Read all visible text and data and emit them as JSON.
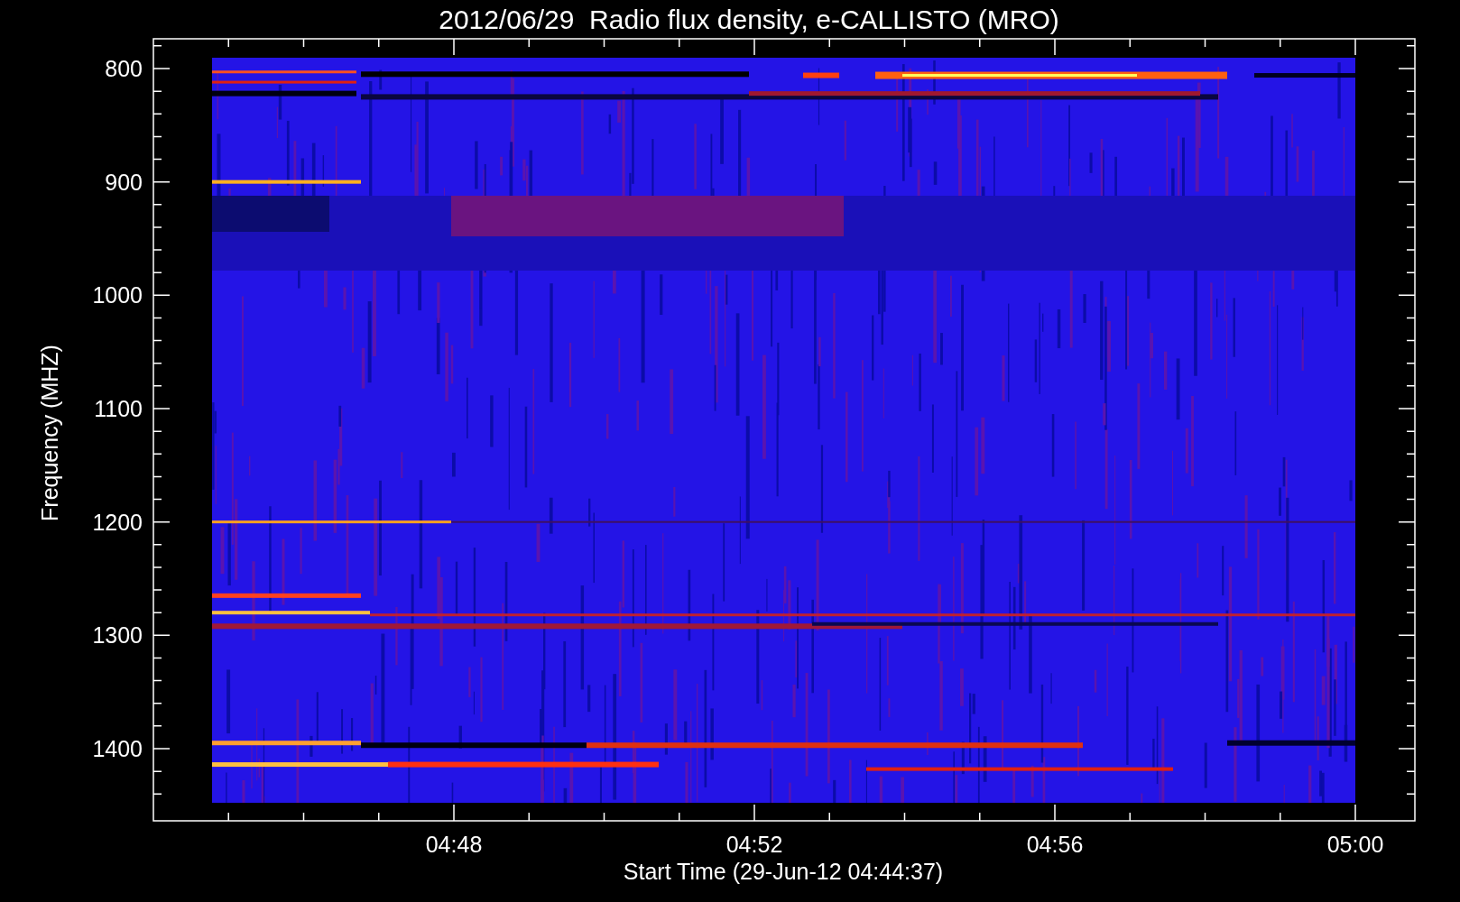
{
  "title": "2012/06/29  Radio flux density, e-CALLISTO (MRO)",
  "y_axis": {
    "label": "Frequency (MHZ)",
    "ticks": [
      "800",
      "900",
      "1000",
      "1100",
      "1200",
      "1300",
      "1400"
    ]
  },
  "x_axis": {
    "label": "Start Time (29-Jun-12 04:44:37)",
    "ticks": [
      "04:48",
      "04:52",
      "04:56",
      "05:00"
    ]
  }
}
